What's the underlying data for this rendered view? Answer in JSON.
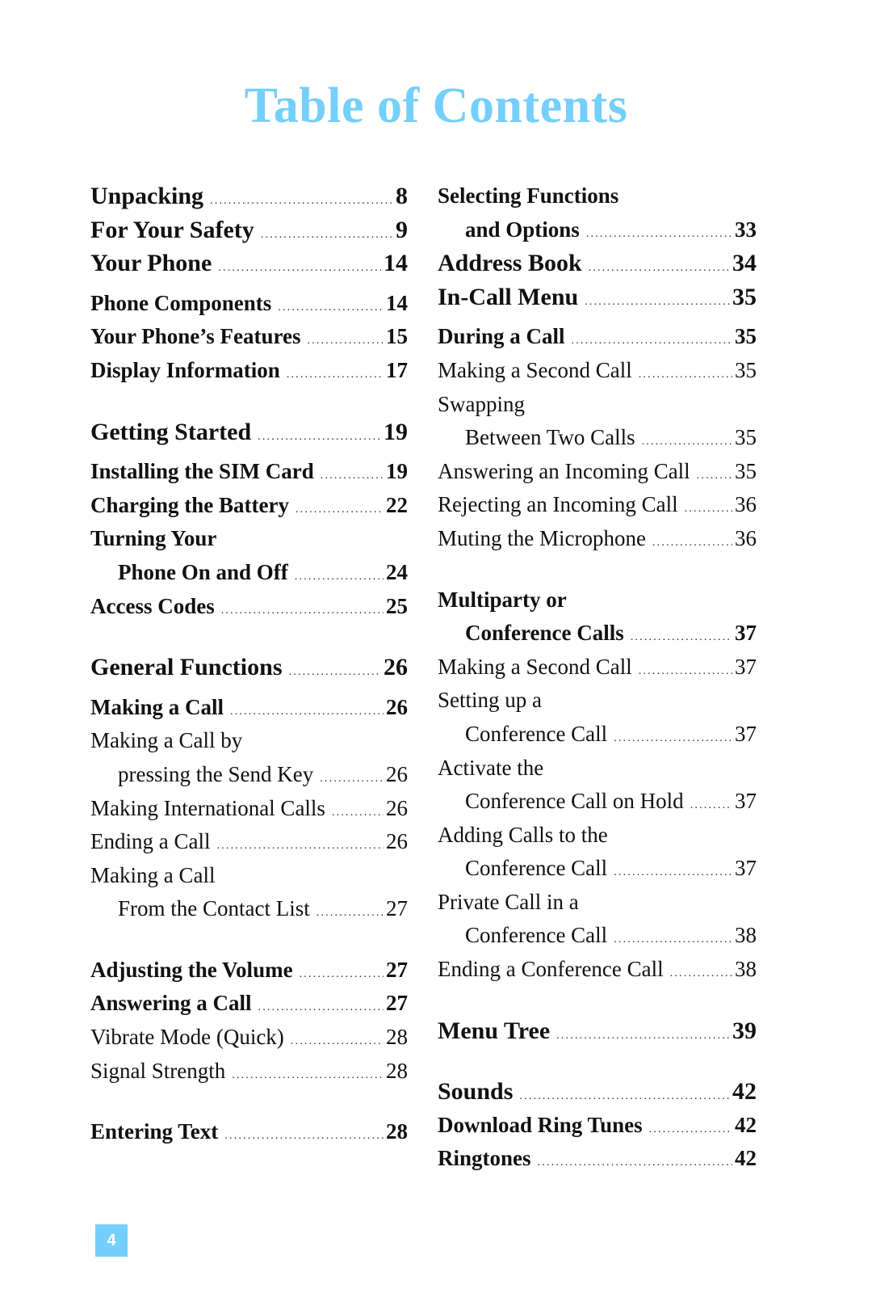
{
  "title": "Table of Contents",
  "accent_color": "#74cffa",
  "page_number": "4",
  "left_column": [
    {
      "label": "Unpacking",
      "page": "8",
      "level": 1
    },
    {
      "label": "For Your Safety",
      "page": "9",
      "level": 1
    },
    {
      "label": "Your Phone",
      "page": "14",
      "level": 1
    },
    {
      "label": "Phone Components",
      "page": "14",
      "level": 2
    },
    {
      "label": "Your Phone’s Features",
      "page": "15",
      "level": 2
    },
    {
      "label": "Display Information",
      "page": "17",
      "level": 2
    },
    {
      "label": "Getting Started",
      "page": "19",
      "level": 1
    },
    {
      "label": "Installing the SIM Card",
      "page": "19",
      "level": 2
    },
    {
      "label": "Charging the Battery",
      "page": "22",
      "level": 2
    },
    {
      "label": "Turning Your",
      "page": "",
      "level": 2
    },
    {
      "label": "Phone On and Off",
      "page": "24",
      "level": 2,
      "indent": true
    },
    {
      "label": "Access Codes",
      "page": "25",
      "level": 2
    },
    {
      "label": "General Functions",
      "page": "26",
      "level": 1
    },
    {
      "label": "Making a Call",
      "page": "26",
      "level": 2
    },
    {
      "label": "Making a Call by",
      "page": "",
      "level": 3
    },
    {
      "label": "pressing the Send Key",
      "page": "26",
      "level": 3,
      "indent": true
    },
    {
      "label": "Making International Calls",
      "page": "26",
      "level": 3
    },
    {
      "label": "Ending a Call",
      "page": "26",
      "level": 3
    },
    {
      "label": "Making a Call",
      "page": "",
      "level": 3
    },
    {
      "label": "From the Contact List",
      "page": "27",
      "level": 3,
      "indent": true
    },
    {
      "label": "Adjusting the Volume",
      "page": "27",
      "level": 2
    },
    {
      "label": "Answering a Call",
      "page": "27",
      "level": 2
    },
    {
      "label": "Vibrate Mode (Quick)",
      "page": "28",
      "level": 3
    },
    {
      "label": "Signal Strength",
      "page": "28",
      "level": 3
    },
    {
      "label": "Entering Text",
      "page": "28",
      "level": 2
    }
  ],
  "right_column": [
    {
      "label": "Selecting Functions",
      "page": "",
      "level": 2
    },
    {
      "label": "and Options",
      "page": "33",
      "level": 2,
      "indent": true
    },
    {
      "label": "Address Book",
      "page": "34",
      "level": 1
    },
    {
      "label": "In-Call Menu",
      "page": "35",
      "level": 1
    },
    {
      "label": "During a Call",
      "page": "35",
      "level": 2
    },
    {
      "label": "Making a Second Call",
      "page": "35",
      "level": 3
    },
    {
      "label": "Swapping",
      "page": "",
      "level": 3
    },
    {
      "label": "Between Two Calls",
      "page": "35",
      "level": 3,
      "indent": true
    },
    {
      "label": "Answering an Incoming Call",
      "page": "35",
      "level": 3
    },
    {
      "label": "Rejecting an Incoming Call",
      "page": "36",
      "level": 3
    },
    {
      "label": "Muting the Microphone",
      "page": "36",
      "level": 3
    },
    {
      "label": "Multiparty or",
      "page": "",
      "level": 2
    },
    {
      "label": "Conference Calls",
      "page": "37",
      "level": 2,
      "indent": true
    },
    {
      "label": "Making a Second Call",
      "page": "37",
      "level": 3
    },
    {
      "label": "Setting up a",
      "page": "",
      "level": 3
    },
    {
      "label": "Conference Call",
      "page": "37",
      "level": 3,
      "indent": true
    },
    {
      "label": "Activate the",
      "page": "",
      "level": 3
    },
    {
      "label": "Conference Call on Hold",
      "page": "37",
      "level": 3,
      "indent": true
    },
    {
      "label": "Adding Calls to the",
      "page": "",
      "level": 3
    },
    {
      "label": "Conference Call",
      "page": "37",
      "level": 3,
      "indent": true
    },
    {
      "label": "Private Call in a",
      "page": "",
      "level": 3
    },
    {
      "label": "Conference Call",
      "page": "38",
      "level": 3,
      "indent": true
    },
    {
      "label": "Ending a Conference Call",
      "page": "38",
      "level": 3
    },
    {
      "label": "Menu Tree",
      "page": "39",
      "level": 1
    },
    {
      "label": "Sounds",
      "page": "42",
      "level": 1
    },
    {
      "label": "Download Ring Tunes",
      "page": "42",
      "level": 2
    },
    {
      "label": "Ringtones",
      "page": "42",
      "level": 2
    }
  ]
}
